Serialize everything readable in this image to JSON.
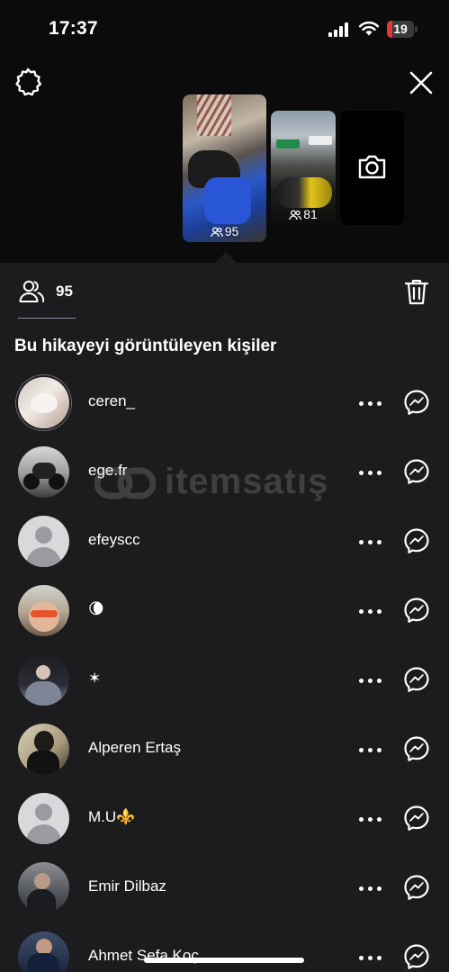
{
  "status_bar": {
    "time": "17:37",
    "battery": "19",
    "battery_level": 0.19
  },
  "stories": [
    {
      "viewers": "95",
      "selected": true
    },
    {
      "viewers": "81",
      "selected": false
    }
  ],
  "summary": {
    "viewer_count": "95"
  },
  "section_title": "Bu hikayeyi görüntüleyen kişiler",
  "watermark": {
    "text": "itemsatış"
  },
  "viewers": [
    {
      "name": "ceren_",
      "avatar": "photo"
    },
    {
      "name": "ege.fr",
      "avatar": "photo"
    },
    {
      "name": "efeyscc",
      "avatar": "default"
    },
    {
      "name": "🌘",
      "avatar": "photo"
    },
    {
      "name": "✶",
      "avatar": "photo"
    },
    {
      "name": "Alperen Ertaş",
      "avatar": "photo"
    },
    {
      "name": "M.U⚜️",
      "avatar": "default"
    },
    {
      "name": "Emir Dilbaz",
      "avatar": "photo"
    },
    {
      "name": "Ahmet Sefa Koç",
      "avatar": "photo"
    }
  ],
  "colors": {
    "background": "#1c1c1e",
    "top_area": "#0b0b0c",
    "battery_red": "#e5373a"
  },
  "icons": [
    "settings-icon",
    "close-icon",
    "camera-icon",
    "people-icon",
    "trash-icon",
    "more-icon",
    "messenger-icon"
  ]
}
